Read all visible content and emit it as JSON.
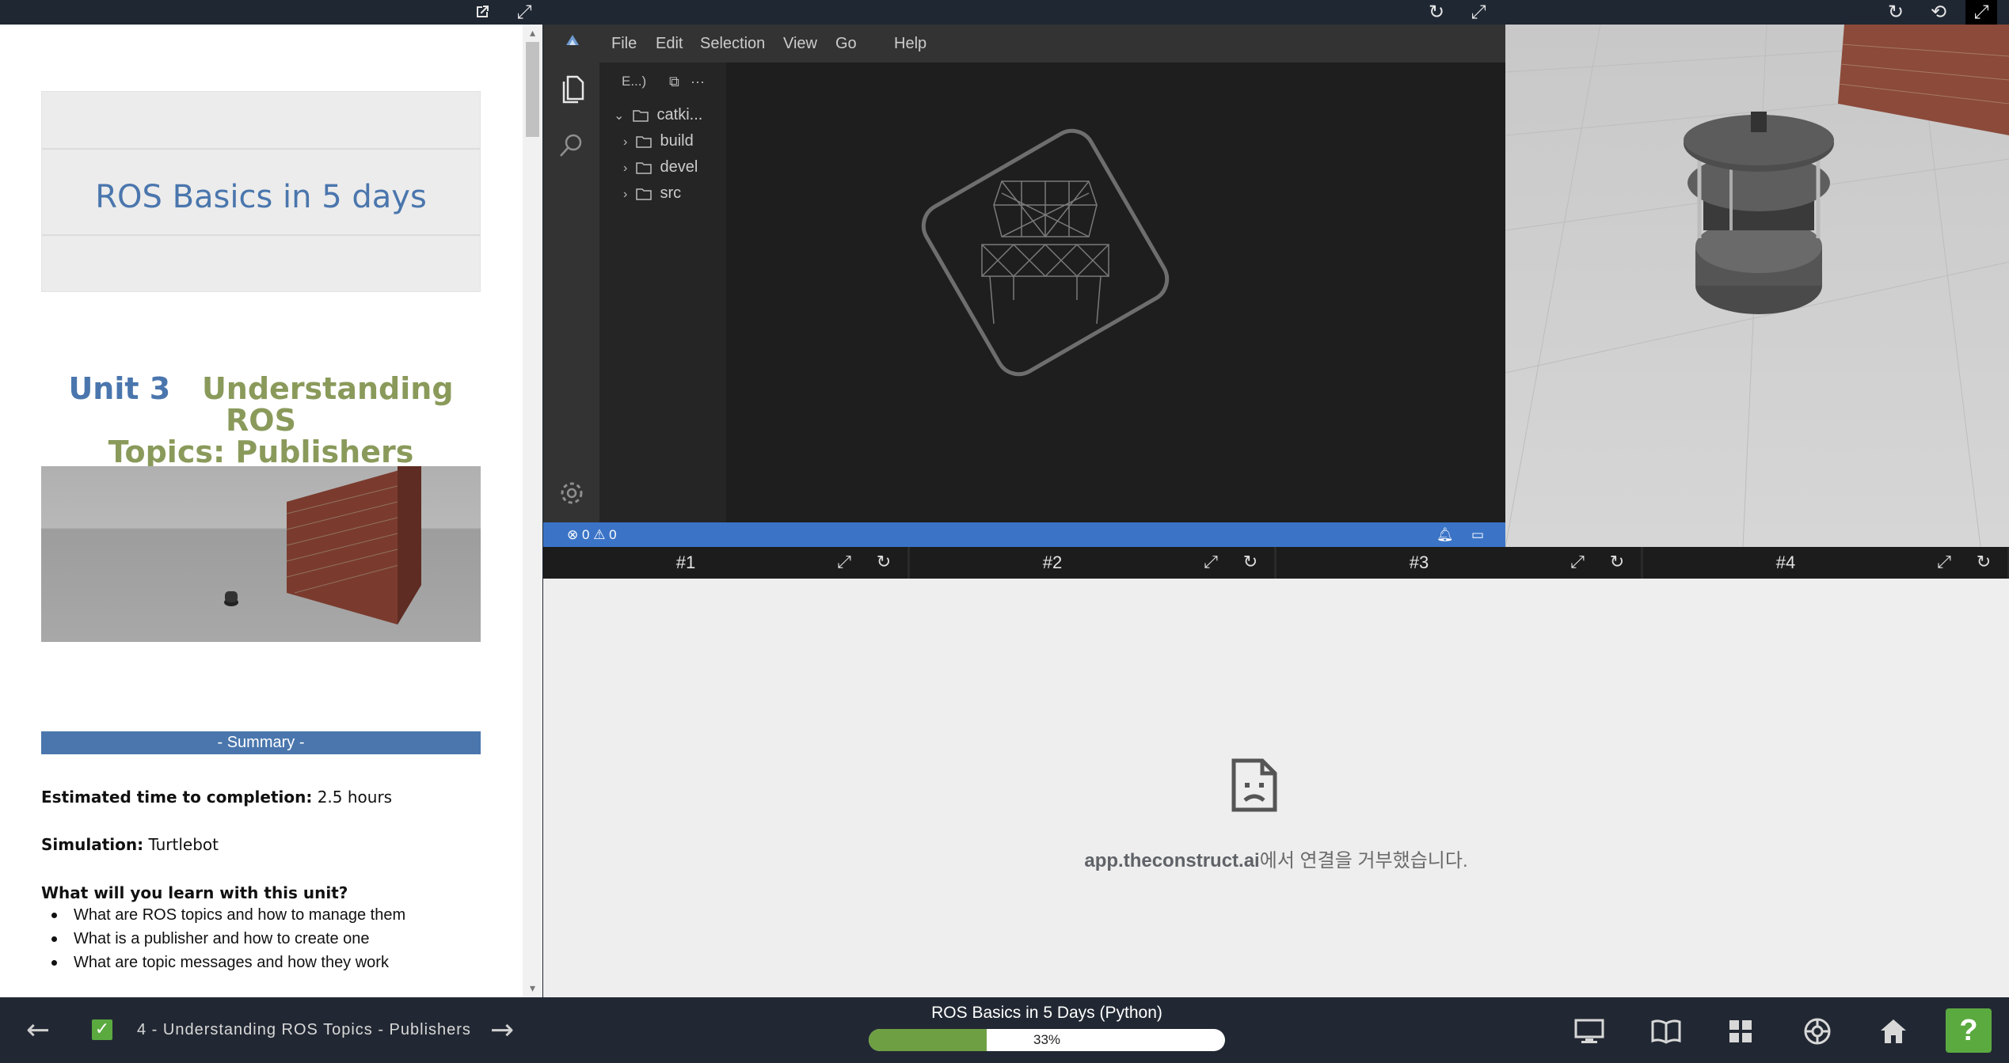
{
  "notebook": {
    "title": "ROS Basics in 5 days",
    "unit_number": "Unit 3",
    "unit_title_line1": "Understanding ROS",
    "unit_title_line2": "Topics: Publishers",
    "summary_label": "- Summary -",
    "time_label": "Estimated time to completion:",
    "time_value": "2.5 hours",
    "sim_label": "Simulation:",
    "sim_value": "Turtlebot",
    "learn_heading": "What will you learn with this unit?",
    "learn_items": [
      "What are ROS topics and how to manage them",
      "What is a publisher and how to create one",
      "What are topic messages and how they work"
    ]
  },
  "ide": {
    "menu": [
      "File",
      "Edit",
      "Selection",
      "View",
      "Go",
      "Help"
    ],
    "explorer_label": "E...)",
    "more_label": "···",
    "tree": {
      "root": "catki...",
      "folders": [
        "build",
        "devel",
        "src"
      ]
    },
    "status": {
      "errors": "0",
      "warnings": "0"
    }
  },
  "terminal_tabs": [
    "#1",
    "#2",
    "#3",
    "#4"
  ],
  "terminal": {
    "error_host": "app.theconstruct.ai",
    "error_suffix": "에서 연결을 거부했습니다."
  },
  "bottom_bar": {
    "unit_label": "4 - Understanding ROS Topics - Publishers",
    "course_title": "ROS Basics in 5 Days (Python)",
    "progress_text": "33%",
    "progress": 0.33,
    "help_label": "?"
  },
  "colors": {
    "accent_blue": "#4a76ad",
    "unit_olive": "#8a9a5b",
    "status_bar": "#3b74c7",
    "progress_green": "#6ea043"
  }
}
